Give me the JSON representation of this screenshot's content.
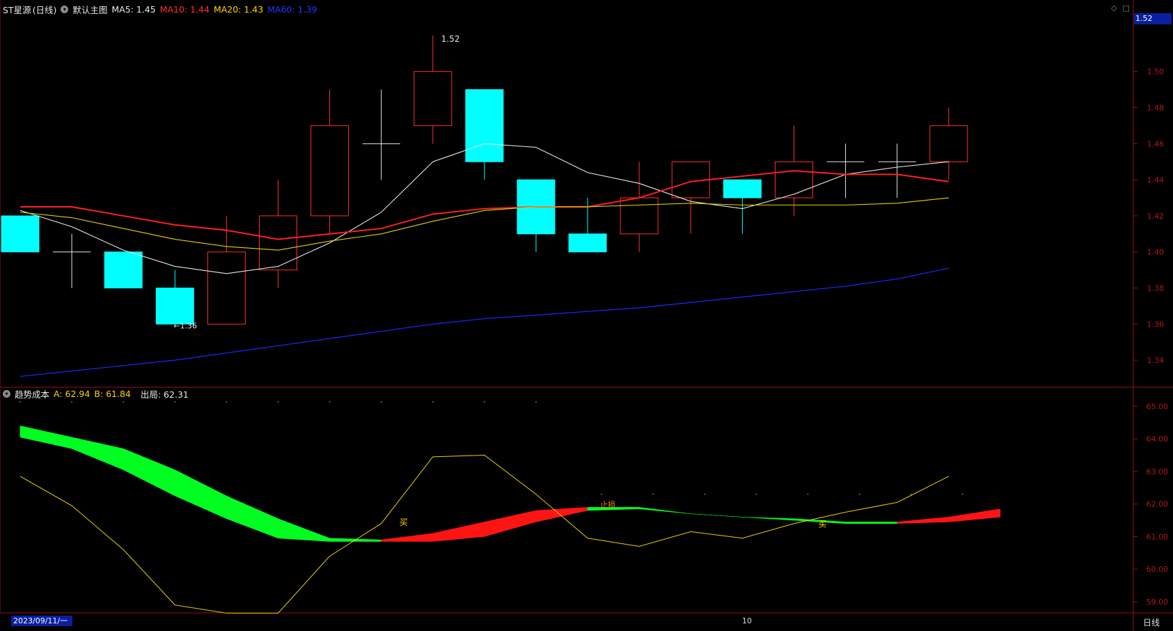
{
  "header": {
    "symbol": "ST星源",
    "period_paren": "(日线)",
    "main_indicator": "默认主图",
    "ma5": "MA5: 1.45",
    "ma10": "MA10: 1.44",
    "ma20": "MA20: 1.43",
    "ma60": "MA60: 1.39"
  },
  "sub_header": {
    "name": "趋势成本",
    "a": "A: 62.94",
    "b": "B: 61.84",
    "out": "出局: 62.31"
  },
  "price_tag": "1.52",
  "date_tag": "2023/09/11/一",
  "period_label": "日线",
  "date_tick": "10",
  "icons": [
    "diamond-icon",
    "square-icon"
  ],
  "colors": {
    "up": "#ff2d2d",
    "down": "#00ffff",
    "ma5": "#e8e8e8",
    "ma10": "#ff2020",
    "ma20": "#e6d200",
    "ma60": "#1a2cff",
    "frame": "#a01010"
  },
  "chart_data": [
    {
      "type": "candlestick",
      "ylim": [
        1.325,
        1.53
      ],
      "y_ticks": [
        "1.34",
        "1.36",
        "1.38",
        "1.40",
        "1.42",
        "1.44",
        "1.46",
        "1.48",
        "1.50"
      ],
      "high_marker": "1.52",
      "low_marker": "1.36",
      "candles": [
        {
          "o": 1.42,
          "h": 1.42,
          "l": 1.4,
          "c": 1.4
        },
        {
          "o": 1.4,
          "h": 1.41,
          "l": 1.38,
          "c": 1.4
        },
        {
          "o": 1.4,
          "h": 1.4,
          "l": 1.38,
          "c": 1.38
        },
        {
          "o": 1.38,
          "h": 1.39,
          "l": 1.36,
          "c": 1.36
        },
        {
          "o": 1.36,
          "h": 1.42,
          "l": 1.36,
          "c": 1.4
        },
        {
          "o": 1.39,
          "h": 1.44,
          "l": 1.38,
          "c": 1.42
        },
        {
          "o": 1.42,
          "h": 1.49,
          "l": 1.41,
          "c": 1.47
        },
        {
          "o": 1.46,
          "h": 1.49,
          "l": 1.44,
          "c": 1.46
        },
        {
          "o": 1.47,
          "h": 1.52,
          "l": 1.46,
          "c": 1.5
        },
        {
          "o": 1.49,
          "h": 1.49,
          "l": 1.44,
          "c": 1.45
        },
        {
          "o": 1.44,
          "h": 1.44,
          "l": 1.4,
          "c": 1.41
        },
        {
          "o": 1.41,
          "h": 1.43,
          "l": 1.41,
          "c": 1.4
        },
        {
          "o": 1.41,
          "h": 1.45,
          "l": 1.4,
          "c": 1.43
        },
        {
          "o": 1.43,
          "h": 1.45,
          "l": 1.41,
          "c": 1.45
        },
        {
          "o": 1.44,
          "h": 1.44,
          "l": 1.41,
          "c": 1.43
        },
        {
          "o": 1.43,
          "h": 1.47,
          "l": 1.42,
          "c": 1.45
        },
        {
          "o": 1.45,
          "h": 1.46,
          "l": 1.43,
          "c": 1.45
        },
        {
          "o": 1.45,
          "h": 1.46,
          "l": 1.43,
          "c": 1.45
        },
        {
          "o": 1.45,
          "h": 1.48,
          "l": 1.44,
          "c": 1.47
        }
      ],
      "series": [
        {
          "name": "MA5",
          "values": [
            1.423,
            1.414,
            1.401,
            1.392,
            1.388,
            1.392,
            1.405,
            1.422,
            1.45,
            1.46,
            1.458,
            1.444,
            1.438,
            1.428,
            1.424,
            1.432,
            1.443,
            1.447,
            1.45
          ]
        },
        {
          "name": "MA10",
          "values": [
            1.425,
            1.425,
            1.42,
            1.415,
            1.412,
            1.407,
            1.41,
            1.413,
            1.421,
            1.424,
            1.425,
            1.425,
            1.43,
            1.439,
            1.442,
            1.445,
            1.443,
            1.443,
            1.439
          ]
        },
        {
          "name": "MA20",
          "values": [
            1.422,
            1.419,
            1.413,
            1.407,
            1.403,
            1.401,
            1.406,
            1.41,
            1.417,
            1.423,
            1.425,
            1.425,
            1.426,
            1.427,
            1.426,
            1.426,
            1.426,
            1.427,
            1.43
          ]
        },
        {
          "name": "MA60",
          "values": [
            1.331,
            1.334,
            1.337,
            1.34,
            1.344,
            1.348,
            1.352,
            1.356,
            1.36,
            1.363,
            1.365,
            1.367,
            1.369,
            1.372,
            1.375,
            1.378,
            1.381,
            1.385,
            1.391
          ]
        }
      ]
    },
    {
      "type": "area",
      "ylim": [
        58.7,
        65.5
      ],
      "y_ticks": [
        "59.00",
        "60.00",
        "61.00",
        "62.00",
        "63.00",
        "64.00",
        "65.00"
      ],
      "labels": [
        "买",
        "止损",
        "买"
      ],
      "series": [
        {
          "name": "A",
          "values": [
            64.4,
            64.05,
            63.7,
            63.05,
            62.25,
            61.55,
            60.95,
            60.9,
            61.1,
            61.45,
            61.8,
            61.9,
            61.85,
            61.7,
            61.6,
            61.5,
            61.4,
            61.45,
            61.6,
            61.85
          ]
        },
        {
          "name": "B",
          "values": [
            64.05,
            63.7,
            63.05,
            62.25,
            61.55,
            60.95,
            60.85,
            60.85,
            60.85,
            61.0,
            61.45,
            61.8,
            61.9,
            61.7,
            61.6,
            61.55,
            61.45,
            61.4,
            61.45,
            61.6
          ]
        },
        {
          "name": "出局",
          "values": [
            62.85,
            61.95,
            60.6,
            58.9,
            58.65,
            58.65,
            60.4,
            61.4,
            63.45,
            63.5,
            62.3,
            60.95,
            60.7,
            61.15,
            60.95,
            61.4,
            61.75,
            62.05,
            62.85
          ]
        }
      ]
    }
  ]
}
